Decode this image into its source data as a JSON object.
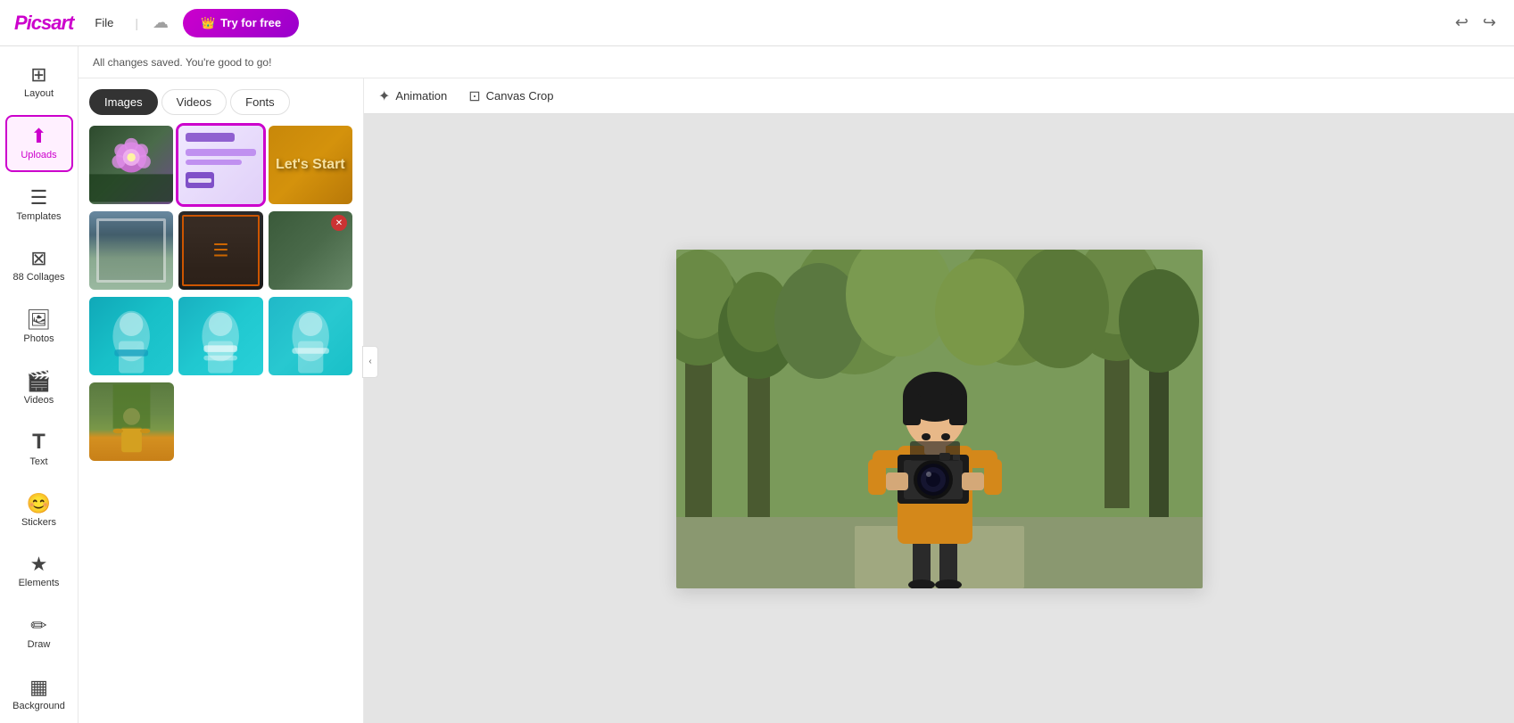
{
  "header": {
    "logo": "Picsart",
    "file_label": "File",
    "try_free_label": "Try for free",
    "undo_icon": "↩",
    "redo_icon": "↪"
  },
  "status": {
    "message": "All changes saved. You're good to go!"
  },
  "sidebar": {
    "items": [
      {
        "id": "layout",
        "label": "Layout",
        "icon": "⊞"
      },
      {
        "id": "uploads",
        "label": "Uploads",
        "icon": "⬆",
        "active": true
      },
      {
        "id": "templates",
        "label": "Templates",
        "icon": "⊟"
      },
      {
        "id": "collages",
        "label": "88 Collages",
        "icon": "⊠"
      },
      {
        "id": "photos",
        "label": "Photos",
        "icon": "🖼"
      },
      {
        "id": "videos",
        "label": "Videos",
        "icon": "🎬"
      },
      {
        "id": "text",
        "label": "Text",
        "icon": "T"
      },
      {
        "id": "stickers",
        "label": "Stickers",
        "icon": "😊"
      },
      {
        "id": "elements",
        "label": "Elements",
        "icon": "★"
      },
      {
        "id": "draw",
        "label": "Draw",
        "icon": "✏"
      },
      {
        "id": "background",
        "label": "Background",
        "icon": "▦"
      }
    ]
  },
  "panel": {
    "tabs": [
      {
        "id": "images",
        "label": "Images",
        "active": true
      },
      {
        "id": "videos",
        "label": "Videos"
      },
      {
        "id": "fonts",
        "label": "Fonts"
      }
    ]
  },
  "canvas_toolbar": {
    "items": [
      {
        "id": "animation",
        "label": "Animation",
        "icon": "✦"
      },
      {
        "id": "canvas_crop",
        "label": "Canvas Crop",
        "icon": "⊡"
      }
    ]
  },
  "collapse_btn_label": "‹"
}
